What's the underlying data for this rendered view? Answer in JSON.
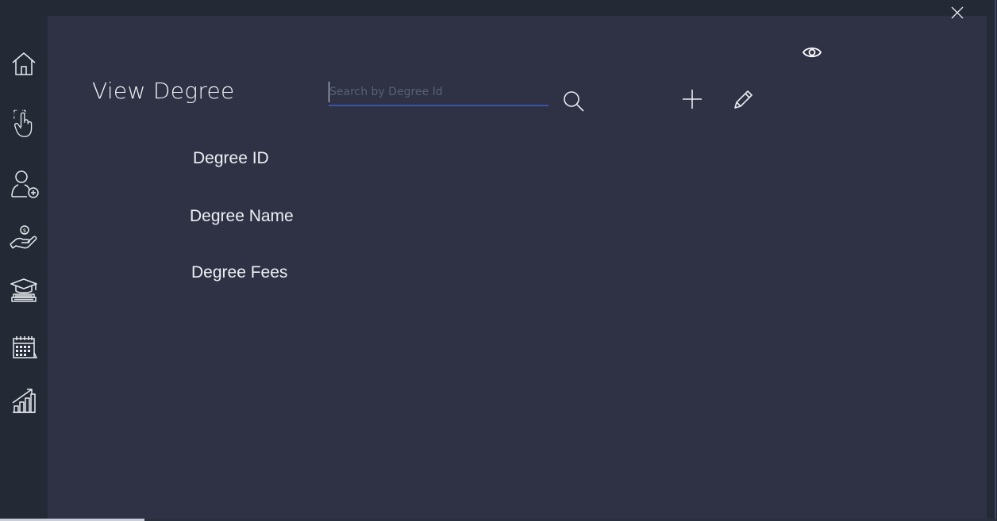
{
  "window": {
    "close_icon": "close-icon"
  },
  "sidebar": {
    "items": [
      {
        "name": "home",
        "icon": "home-icon"
      },
      {
        "name": "select",
        "icon": "touch-select-icon"
      },
      {
        "name": "add-user",
        "icon": "user-add-icon"
      },
      {
        "name": "payments",
        "icon": "hand-money-icon"
      },
      {
        "name": "degrees",
        "icon": "graduation-cap-books-icon"
      },
      {
        "name": "calendar",
        "icon": "calendar-icon"
      },
      {
        "name": "reports",
        "icon": "growth-chart-icon"
      }
    ]
  },
  "header": {
    "title": "View Degree"
  },
  "search": {
    "value": "",
    "placeholder": "Search by Degree Id",
    "button_icon": "search-icon"
  },
  "toolbar": {
    "view_icon": "eye-icon",
    "add_icon": "plus-icon",
    "edit_icon": "pencil-icon"
  },
  "fields": {
    "degree_id": "Degree ID",
    "degree_name": "Degree Name",
    "degree_fees": "Degree Fees"
  },
  "colors": {
    "background": "#232a35",
    "panel": "#2f3245",
    "accent": "#3a53a5",
    "text": "#eef0f4"
  }
}
